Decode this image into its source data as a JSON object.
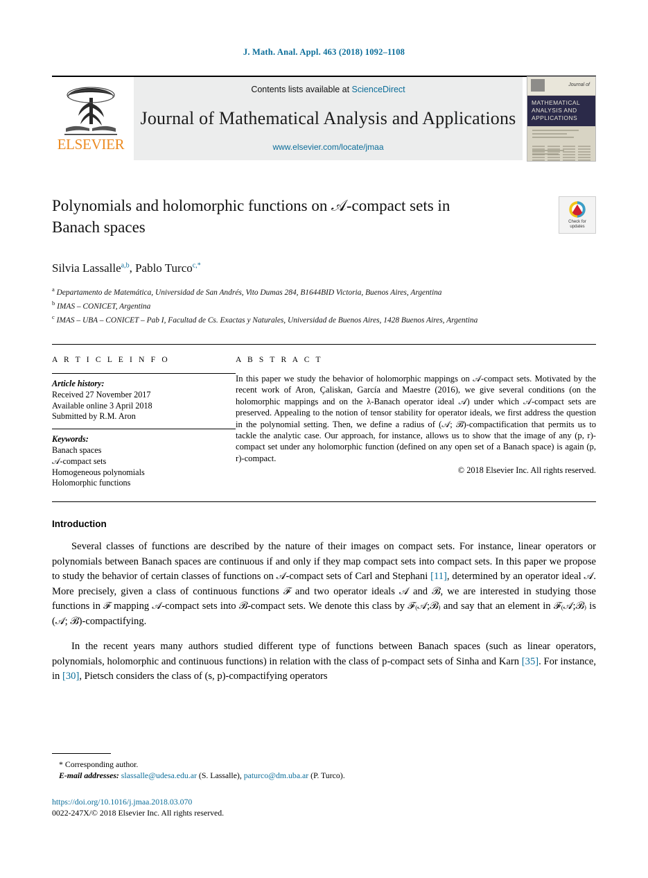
{
  "running_head": "J. Math. Anal. Appl. 463 (2018) 1092–1108",
  "masthead": {
    "publisher_wordmark": "ELSEVIER",
    "contents_prefix": "Contents lists available at ",
    "contents_link": "ScienceDirect",
    "journal_title": "Journal of Mathematical Analysis and Applications",
    "journal_url": "www.elsevier.com/locate/jmaa",
    "cover": {
      "journal_of": "Journal of",
      "band_line1": "MATHEMATICAL",
      "band_line2": "ANALYSIS AND",
      "band_line3": "APPLICATIONS"
    }
  },
  "article": {
    "title": "Polynomials and holomorphic functions on 𝒜-compact sets in Banach spaces",
    "authors": "Silvia Lassalle",
    "author1_sup": "a,b",
    "author2": ", Pablo Turco",
    "author2_sup": "c,*",
    "affiliations": [
      {
        "marker": "a",
        "text": "Departamento de Matemática, Universidad de San Andrés, Vito Dumas 284, B1644BID Victoria, Buenos Aires, Argentina"
      },
      {
        "marker": "b",
        "text": "IMAS – CONICET, Argentina"
      },
      {
        "marker": "c",
        "text": "IMAS – UBA – CONICET – Pab I, Facultad de Cs. Exactas y Naturales, Universidad de Buenos Aires, 1428 Buenos Aires, Argentina"
      }
    ],
    "crossmark": {
      "line1": "Check for",
      "line2": "updates"
    }
  },
  "info": {
    "heading": "A R T I C L E   I N F O",
    "history_label": "Article history:",
    "history": [
      "Received 27 November 2017",
      "Available online 3 April 2018",
      "Submitted by R.M. Aron"
    ],
    "keywords_label": "Keywords:",
    "keywords": [
      "Banach spaces",
      "𝒜-compact sets",
      "Homogeneous polynomials",
      "Holomorphic functions"
    ]
  },
  "abstract": {
    "heading": "A B S T R A C T",
    "text": "In this paper we study the behavior of holomorphic mappings on 𝒜-compact sets. Motivated by the recent work of Aron, Çaliskan, García and Maestre (2016), we give several conditions (on the holomorphic mappings and on the λ-Banach operator ideal 𝒜) under which 𝒜-compact sets are preserved. Appealing to the notion of tensor stability for operator ideals, we first address the question in the polynomial setting. Then, we define a radius of (𝒜; ℬ)-compactification that permits us to tackle the analytic case. Our approach, for instance, allows us to show that the image of any (p, r)-compact set under any holomorphic function (defined on any open set of a Banach space) is again (p, r)-compact.",
    "copyright": "© 2018 Elsevier Inc. All rights reserved."
  },
  "body": {
    "intro_heading": "Introduction",
    "paragraph1_a": "Several classes of functions are described by the nature of their images on compact sets. For instance, linear operators or polynomials between Banach spaces are continuous if and only if they map compact sets into compact sets. In this paper we propose to study the behavior of certain classes of functions on 𝒜-compact sets of Carl and Stephani ",
    "p1_cite1": "[11]",
    "paragraph1_b": ", determined by an operator ideal 𝒜. More precisely, given a class of continuous functions ℱ and two operator ideals 𝒜 and ℬ, we are interested in studying those functions in ℱ mapping 𝒜-compact sets into ℬ-compact sets. We denote this class by ℱ₍𝒜;ℬ₎ and say that an element in ℱ₍𝒜;ℬ₎ is (𝒜; ℬ)-compactifying.",
    "paragraph2_a": "In the recent years many authors studied different type of functions between Banach spaces (such as linear operators, polynomials, holomorphic and continuous functions) in relation with the class of p-compact sets of Sinha and Karn ",
    "p2_cite1": "[35]",
    "paragraph2_b": ". For instance, in ",
    "p2_cite2": "[30]",
    "paragraph2_c": ", Pietsch considers the class of (s, p)-compactifying operators"
  },
  "footer": {
    "corresponding": "Corresponding author.",
    "email_label": "E-mail addresses:",
    "email1": "slassalle@udesa.edu.ar",
    "email1_owner": "(S. Lassalle),",
    "email2": "paturco@dm.uba.ar",
    "email2_owner": "(P. Turco).",
    "doi": "https://doi.org/10.1016/j.jmaa.2018.03.070",
    "issn_line": "0022-247X/© 2018 Elsevier Inc. All rights reserved."
  },
  "colors": {
    "link_blue": "#0b6d99",
    "elsevier_orange": "#ec8b22",
    "band_gray": "#eceded",
    "cover_navy": "#2b2a49"
  }
}
